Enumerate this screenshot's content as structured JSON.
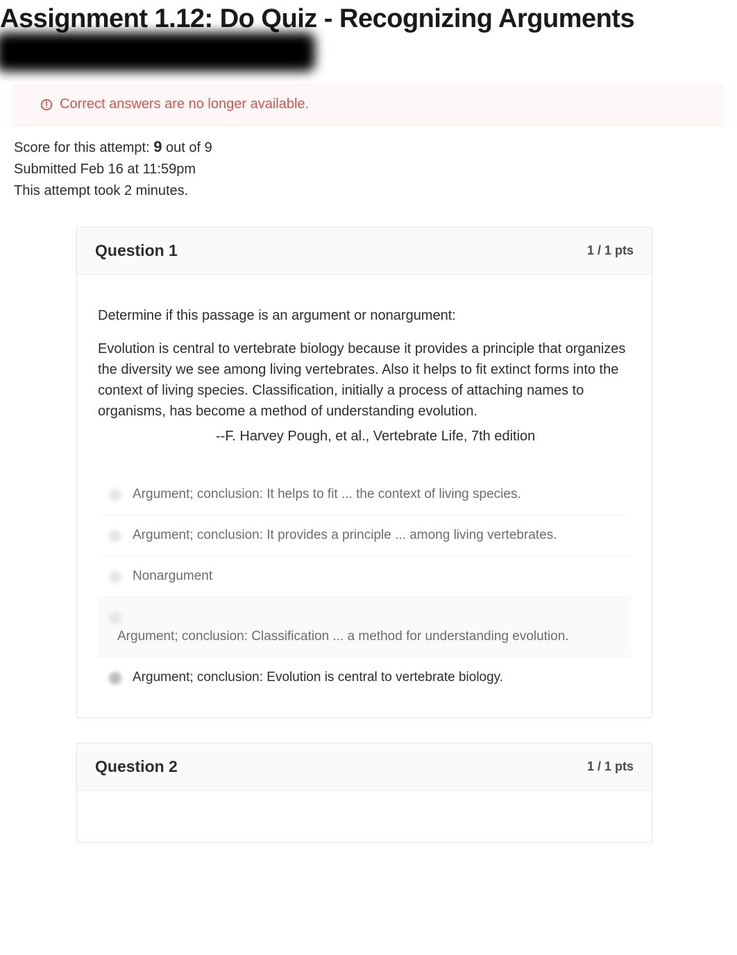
{
  "title": "Assignment 1.12: Do Quiz - Recognizing Arguments",
  "alert_text": "Correct answers are no longer available.",
  "score": {
    "label_prefix": "Score for this attempt: ",
    "earned": "9",
    "label_suffix": " out of 9"
  },
  "submitted": "Submitted Feb 16 at 11:59pm",
  "duration": "This attempt took 2 minutes.",
  "questions": [
    {
      "title": "Question 1",
      "points": "1 / 1 pts",
      "prompt": "Determine if this passage is an argument or nonargument:",
      "passage": "Evolution is central to vertebrate biology because it provides a principle that organizes the diversity we see among living vertebrates. Also it helps to fit extinct forms into the context of living species. Classification, initially a process of attaching names to organisms, has become a method of understanding evolution.",
      "citation": "--F. Harvey Pough, et al., Vertebrate Life, 7th edition",
      "answers": [
        {
          "text": "Argument; conclusion: It helps to fit ... the context of living species."
        },
        {
          "text": "Argument; conclusion: It provides a principle ... among living vertebrates."
        },
        {
          "text": "Nonargument"
        },
        {
          "text": "Argument; conclusion: Classification ... a method for understanding evolution."
        },
        {
          "text": "Argument; conclusion: Evolution is central to vertebrate biology."
        }
      ]
    },
    {
      "title": "Question 2",
      "points": "1 / 1 pts"
    }
  ]
}
